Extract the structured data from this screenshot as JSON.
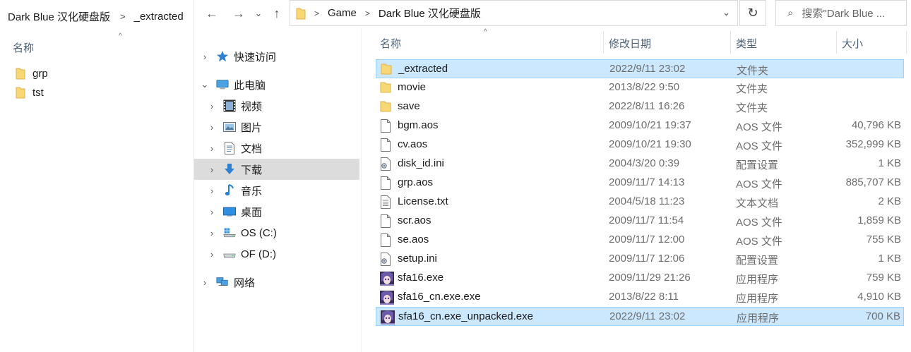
{
  "left_window": {
    "breadcrumb": [
      "Dark Blue 汉化硬盘版",
      "_extracted"
    ],
    "column_header": "名称",
    "items": [
      {
        "name": "grp",
        "icon": "folder-icon"
      },
      {
        "name": "tst",
        "icon": "folder-icon"
      }
    ]
  },
  "main_window": {
    "nav_buttons": {
      "back": "←",
      "forward": "→",
      "recent": "⌄",
      "up": "↑"
    },
    "address": {
      "crumbs": [
        "Game",
        "Dark Blue 汉化硬盘版"
      ]
    },
    "search": {
      "placeholder": "搜索\"Dark Blue ..."
    },
    "nav_pane": [
      {
        "label": "快速访问",
        "icon": "star-icon",
        "chev": "›",
        "level": 0,
        "selected": false
      },
      {
        "label": "此电脑",
        "icon": "computer-icon",
        "chev": "⌄",
        "level": 0,
        "selected": false
      },
      {
        "label": "视频",
        "icon": "video-icon",
        "chev": "›",
        "level": 1,
        "selected": false
      },
      {
        "label": "图片",
        "icon": "pictures-icon",
        "chev": "›",
        "level": 1,
        "selected": false
      },
      {
        "label": "文档",
        "icon": "documents-icon",
        "chev": "›",
        "level": 1,
        "selected": false
      },
      {
        "label": "下载",
        "icon": "download-icon",
        "chev": "›",
        "level": 1,
        "selected": true
      },
      {
        "label": "音乐",
        "icon": "music-icon",
        "chev": "›",
        "level": 1,
        "selected": false
      },
      {
        "label": "桌面",
        "icon": "desktop-icon",
        "chev": "›",
        "level": 1,
        "selected": false
      },
      {
        "label": "OS (C:)",
        "icon": "windows-drive-icon",
        "chev": "›",
        "level": 1,
        "selected": false
      },
      {
        "label": "OF (D:)",
        "icon": "drive-icon",
        "chev": "›",
        "level": 1,
        "selected": false
      },
      {
        "label": "网络",
        "icon": "network-icon",
        "chev": "›",
        "level": 0,
        "selected": false
      }
    ],
    "columns": {
      "name": "名称",
      "date": "修改日期",
      "type": "类型",
      "size": "大小"
    },
    "files": [
      {
        "name": "_extracted",
        "date": "2022/9/11 23:02",
        "type": "文件夹",
        "size": "",
        "icon": "folder-icon",
        "selected": true
      },
      {
        "name": "movie",
        "date": "2013/8/22 9:50",
        "type": "文件夹",
        "size": "",
        "icon": "folder-icon",
        "selected": false
      },
      {
        "name": "save",
        "date": "2022/8/11 16:26",
        "type": "文件夹",
        "size": "",
        "icon": "folder-icon",
        "selected": false
      },
      {
        "name": "bgm.aos",
        "date": "2009/10/21 19:37",
        "type": "AOS 文件",
        "size": "40,796 KB",
        "icon": "file-icon",
        "selected": false
      },
      {
        "name": "cv.aos",
        "date": "2009/10/21 19:30",
        "type": "AOS 文件",
        "size": "352,999 KB",
        "icon": "file-icon",
        "selected": false
      },
      {
        "name": "disk_id.ini",
        "date": "2004/3/20 0:39",
        "type": "配置设置",
        "size": "1 KB",
        "icon": "settings-file-icon",
        "selected": false
      },
      {
        "name": "grp.aos",
        "date": "2009/11/7 14:13",
        "type": "AOS 文件",
        "size": "885,707 KB",
        "icon": "file-icon",
        "selected": false
      },
      {
        "name": "License.txt",
        "date": "2004/5/18 11:23",
        "type": "文本文档",
        "size": "2 KB",
        "icon": "text-file-icon",
        "selected": false
      },
      {
        "name": "scr.aos",
        "date": "2009/11/7 11:54",
        "type": "AOS 文件",
        "size": "1,859 KB",
        "icon": "file-icon",
        "selected": false
      },
      {
        "name": "se.aos",
        "date": "2009/11/7 12:00",
        "type": "AOS 文件",
        "size": "755 KB",
        "icon": "file-icon",
        "selected": false
      },
      {
        "name": "setup.ini",
        "date": "2009/11/7 12:06",
        "type": "配置设置",
        "size": "1 KB",
        "icon": "settings-file-icon",
        "selected": false
      },
      {
        "name": "sfa16.exe",
        "date": "2009/11/29 21:26",
        "type": "应用程序",
        "size": "759 KB",
        "icon": "app-icon",
        "selected": false
      },
      {
        "name": "sfa16_cn.exe.exe",
        "date": "2013/8/22 8:11",
        "type": "应用程序",
        "size": "4,910 KB",
        "icon": "app-icon",
        "selected": false
      },
      {
        "name": "sfa16_cn.exe_unpacked.exe",
        "date": "2022/9/11 23:02",
        "type": "应用程序",
        "size": "700 KB",
        "icon": "app-icon",
        "selected": true
      }
    ]
  }
}
